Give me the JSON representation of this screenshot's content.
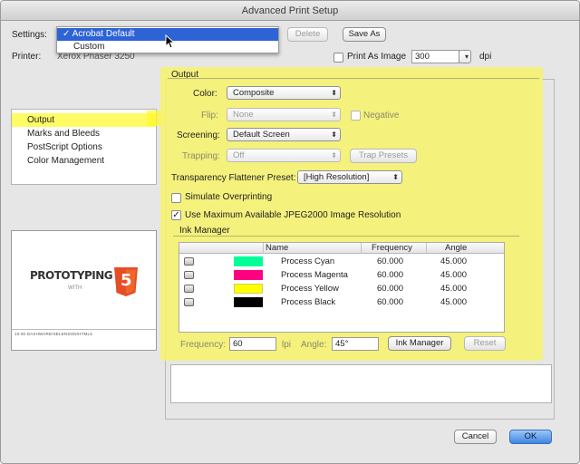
{
  "window": {
    "title": "Advanced Print Setup"
  },
  "settings": {
    "label": "Settings:",
    "options": [
      "Acrobat Default",
      "Custom"
    ],
    "selected_mark": "✓",
    "delete_label": "Delete",
    "save_as_label": "Save As"
  },
  "printer": {
    "label": "Printer:",
    "name": "Xerox Phaser 3250",
    "print_as_image_label": "Print As Image",
    "dpi_value": "300",
    "dpi_label": "dpi"
  },
  "sidebar": {
    "items": [
      {
        "label": "Output"
      },
      {
        "label": "Marks and Bleeds"
      },
      {
        "label": "PostScript Options"
      },
      {
        "label": "Color Management"
      }
    ]
  },
  "preview": {
    "title_text": "PROTOTYPING",
    "sub_text": "WITH",
    "badge_text": "5",
    "footer_text": "10:00 DASHWARE/SELENSON/HTML5"
  },
  "output": {
    "section_label": "Output",
    "color_label": "Color:",
    "color_value": "Composite",
    "flip_label": "Flip:",
    "flip_value": "None",
    "negative_label": "Negative",
    "screening_label": "Screening:",
    "screening_value": "Default Screen",
    "trapping_label": "Trapping:",
    "trapping_value": "Off",
    "trap_presets_label": "Trap Presets",
    "flattener_label": "Transparency Flattener Preset:",
    "flattener_value": "[High Resolution]",
    "simulate_label": "Simulate Overprinting",
    "jpeg_label": "Use Maximum Available JPEG2000 Image Resolution",
    "jpeg_checked": "✓"
  },
  "ink_manager": {
    "label": "Ink Manager",
    "columns": [
      "Name",
      "Frequency",
      "Angle"
    ],
    "rows": [
      {
        "name": "Process Cyan",
        "frequency": "60.000",
        "angle": "45.000",
        "color": "#00ff99"
      },
      {
        "name": "Process Magenta",
        "frequency": "60.000",
        "angle": "45.000",
        "color": "#ff0080"
      },
      {
        "name": "Process Yellow",
        "frequency": "60.000",
        "angle": "45.000",
        "color": "#ffff00"
      },
      {
        "name": "Process Black",
        "frequency": "60.000",
        "angle": "45.000",
        "color": "#000000"
      }
    ],
    "frequency_label": "Frequency:",
    "frequency_value": "60",
    "lpi_label": "lpi",
    "angle_label": "Angle:",
    "angle_value": "45°",
    "ink_manager_button": "Ink Manager",
    "reset_button": "Reset"
  },
  "footer": {
    "cancel_label": "Cancel",
    "ok_label": "OK"
  },
  "colors": {
    "highlight": "#f6f26e",
    "accent": "#2e63d6",
    "html5_orange": "#e44d26"
  }
}
